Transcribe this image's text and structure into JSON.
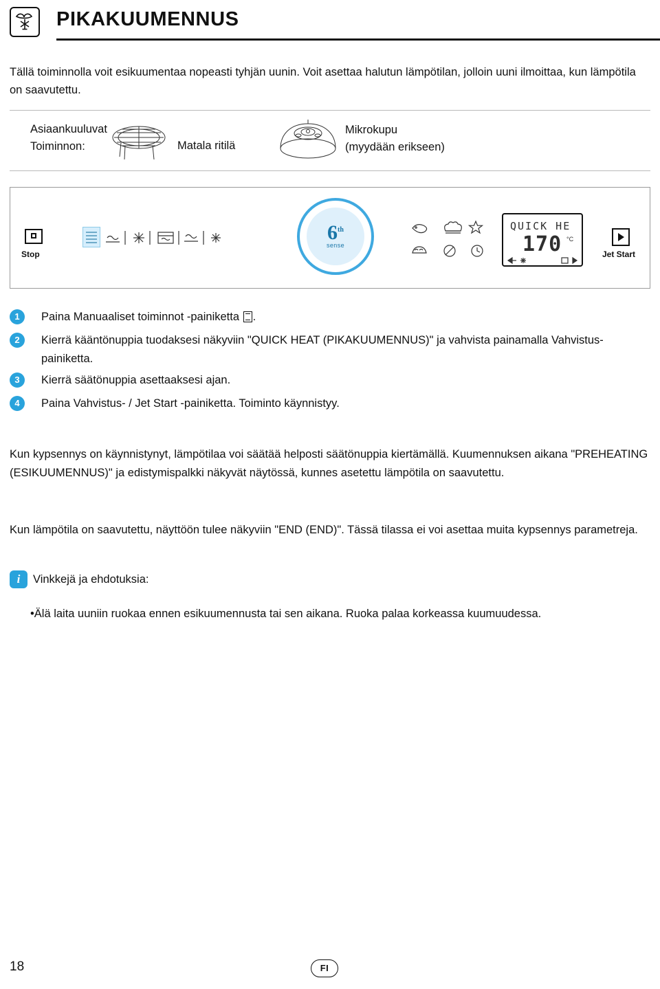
{
  "header": {
    "title": "PIKAKUUMENNUS",
    "icon": "fan-snowflake-icon"
  },
  "intro": "Tällä toiminnolla voit esikuumentaa nopeasti tyhjän uunin. Voit asettaa halutun lämpötilan, jolloin uuni ilmoittaa, kun lämpötila on saavutettu.",
  "accessories": {
    "label_line1": "Asiaankuuluvat",
    "label_line2": "Toiminnon:",
    "items": [
      {
        "name": "Matala ritilä",
        "icon": "low-rack-icon"
      },
      {
        "name_line1": "Mikrokupu",
        "name_line2": "(myydään erikseen)",
        "icon": "crisp-lid-icon"
      }
    ]
  },
  "panel": {
    "stop_label": "Stop",
    "jet_start_label": "Jet Start",
    "knob": {
      "digit": "6",
      "superscript": "th",
      "caption": "sense"
    },
    "display": {
      "text": "QUICK HE",
      "value": "170",
      "unit": "°C"
    }
  },
  "steps": [
    {
      "num": "1",
      "text_before": "Paina Manuaaliset toiminnot -painiketta ",
      "text_after": "."
    },
    {
      "num": "2",
      "text": "Kierrä kääntönuppia tuodaksesi näkyviin \"QUICK HEAT (PIKAKUUMENNUS)\" ja vahvista painamalla Vahvistus-painiketta."
    },
    {
      "num": "3",
      "text": "Kierrä säätönuppia asettaaksesi ajan."
    },
    {
      "num": "4",
      "text": "Paina Vahvistus- / Jet Start -painiketta. Toiminto käynnistyy."
    }
  ],
  "paragraphs": {
    "p1": "Kun kypsennys on käynnistynyt, lämpötilaa voi säätää helposti säätönuppia kiertämällä. Kuumennuksen aikana \"PREHEATING (ESIKUUMENNUS)\" ja edistymispalkki näkyvät näytössä, kunnes asetettu lämpötila on saavutettu.",
    "p2": "Kun lämpötila on saavutettu, näyttöön tulee näkyviin \"END (END)\". Tässä tilassa ei voi asettaa muita kypsennys parametreja."
  },
  "tips": {
    "icon_glyph": "i",
    "title": "Vinkkejä ja ehdotuksia:",
    "bullet": "•Älä laita uuniin ruokaa ennen esikuumennusta tai sen aikana. Ruoka palaa korkeassa kuumuudessa."
  },
  "footer": {
    "page_number": "18",
    "language": "FI"
  },
  "colors": {
    "accent": "#29a3dc",
    "knob_ring": "#3fa9e0",
    "rule": "#111111"
  }
}
